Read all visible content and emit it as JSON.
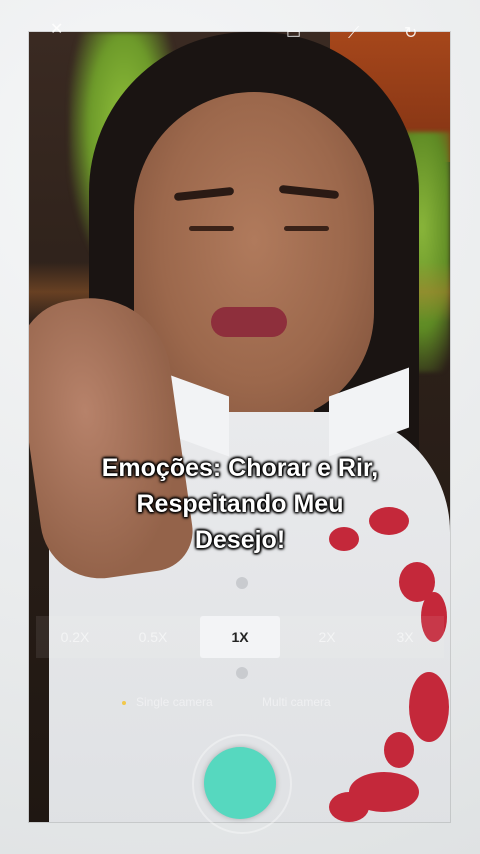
{
  "caption": {
    "lines": [
      "Emoções: Chorar e Rir,",
      "Respeitando Meu",
      "Desejo!"
    ]
  },
  "zoom": {
    "options": [
      "0.2X",
      "0.5X",
      "1X",
      "2X",
      "3X"
    ],
    "selected": "1X"
  },
  "camera_modes": {
    "items": [
      "Single camera",
      "Multi camera"
    ],
    "selected": "Single camera"
  },
  "top_icons": [
    "close-icon",
    "frame-icon",
    "magic-wand-icon",
    "refresh-icon"
  ],
  "colors": {
    "shutter": "#56d8bf",
    "active_mode_dot": "#f2c84b"
  }
}
